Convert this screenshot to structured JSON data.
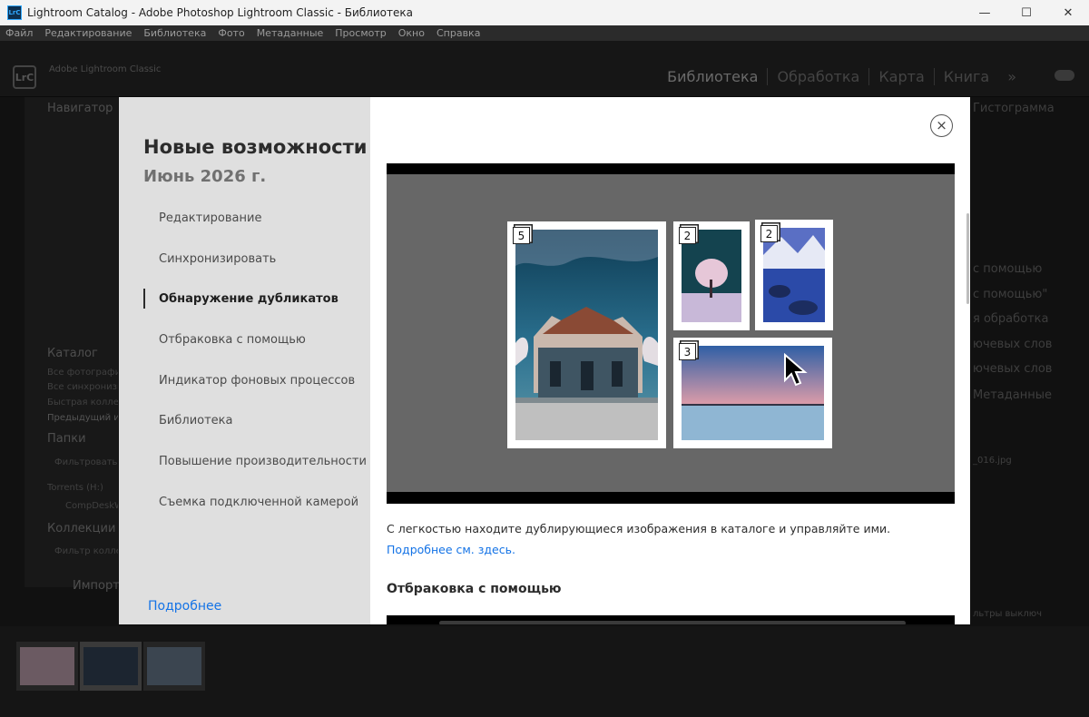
{
  "window": {
    "title": "Lightroom Catalog - Adobe Photoshop Lightroom Classic - Библиотека",
    "app_icon_text": "LrC",
    "controls": {
      "minimize": "—",
      "maximize": "☐",
      "close": "✕"
    }
  },
  "menu": [
    "Файл",
    "Редактирование",
    "Библиотека",
    "Фото",
    "Метаданные",
    "Просмотр",
    "Окно",
    "Справка"
  ],
  "app": {
    "brand": "Adobe Lightroom Classic",
    "logo_text": "LrC",
    "modules": [
      "Библиотека",
      "Обработка",
      "Карта",
      "Книга",
      "»"
    ],
    "left_panel": {
      "navigator": "Навигатор",
      "catalog": "Каталог",
      "catalog_items": [
        "Все фотографии",
        "Все синхронизи",
        "Быстрая коллекц",
        "Предыдущий им"
      ],
      "folders": "Папки",
      "folder_filter": "Фильтровать па",
      "drive": "Torrents (H:)",
      "folder": "CompDeskW",
      "collections": "Коллекции",
      "collection_filter": "Фильтр коллекц",
      "import": "Импорт"
    },
    "right_panel": {
      "histogram": "Гистограмма",
      "items": [
        "с помощью",
        "с помощью\"",
        "я обработка",
        "ючевых слов",
        "ючевых слов",
        "Метаданные"
      ],
      "filename": "_016.jpg",
      "filters": "льтры выключ"
    }
  },
  "modal": {
    "title": "Новые возможности",
    "subtitle": "Июнь 2026 г.",
    "nav": [
      {
        "label": "Редактирование",
        "active": false
      },
      {
        "label": "Синхронизировать",
        "active": false
      },
      {
        "label": "Обнаружение дубликатов",
        "active": true
      },
      {
        "label": "Отбраковка с помощью",
        "active": false
      },
      {
        "label": "Индикатор фоновых процессов",
        "active": false
      },
      {
        "label": "Библиотека",
        "active": false
      },
      {
        "label": "Повышение производительности",
        "active": false
      },
      {
        "label": "Съемка подключенной камерой",
        "active": false
      }
    ],
    "learn_more": "Подробнее",
    "close_icon": "×",
    "stack_counts": [
      "5",
      "2",
      "2",
      "3"
    ],
    "description": "С легкостью находите дублирующиеся изображения в каталоге и управляйте ими.",
    "description_link": "Подробнее см. здесь.",
    "next_section": "Отбраковка с помощью"
  }
}
